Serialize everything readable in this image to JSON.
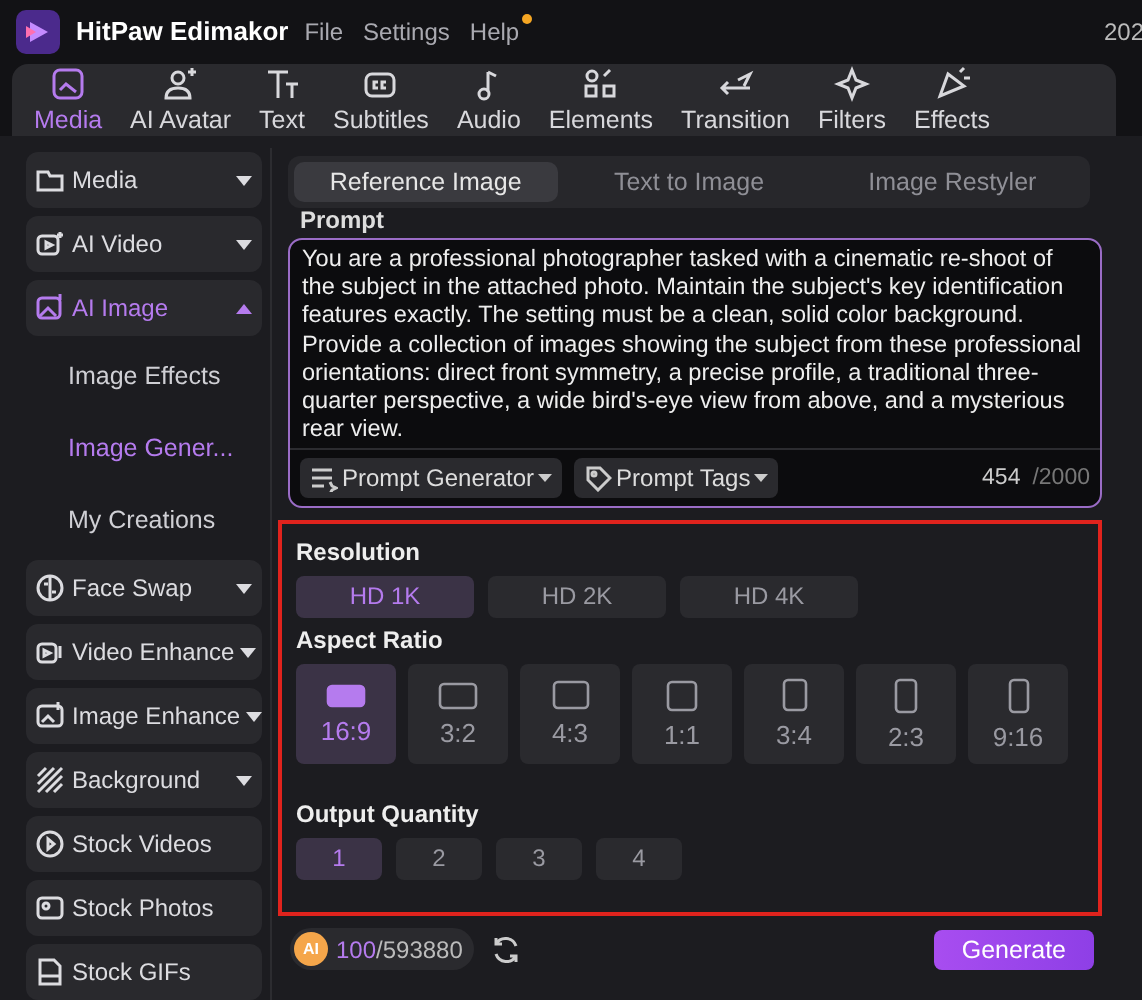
{
  "app": {
    "name": "HitPaw Edimakor",
    "menu": [
      {
        "label": "File",
        "badge": false
      },
      {
        "label": "Settings",
        "badge": false
      },
      {
        "label": "Help",
        "badge": true
      }
    ],
    "clock": "202"
  },
  "toolbar": [
    {
      "label": "Media",
      "selected": true
    },
    {
      "label": "AI Avatar",
      "selected": false
    },
    {
      "label": "Text",
      "selected": false
    },
    {
      "label": "Subtitles",
      "selected": false
    },
    {
      "label": "Audio",
      "selected": false
    },
    {
      "label": "Elements",
      "selected": false
    },
    {
      "label": "Transition",
      "selected": false
    },
    {
      "label": "Filters",
      "selected": false
    },
    {
      "label": "Effects",
      "selected": false
    }
  ],
  "sidebar": {
    "items": [
      {
        "kind": "group",
        "label": "Media",
        "expanded": false,
        "selected": false
      },
      {
        "kind": "group",
        "label": "AI Video",
        "expanded": false,
        "selected": false
      },
      {
        "kind": "group",
        "label": "AI Image",
        "expanded": true,
        "selected": true,
        "children": [
          {
            "label": "Image Effects",
            "selected": false
          },
          {
            "label": "Image Gener...",
            "selected": true
          },
          {
            "label": "My Creations",
            "selected": false
          }
        ]
      },
      {
        "kind": "group",
        "label": "Face Swap",
        "expanded": false,
        "selected": false
      },
      {
        "kind": "group",
        "label": "Video Enhance",
        "expanded": false,
        "selected": false
      },
      {
        "kind": "group",
        "label": "Image Enhance",
        "expanded": false,
        "selected": false
      },
      {
        "kind": "group",
        "label": "Background",
        "expanded": false,
        "selected": false
      },
      {
        "kind": "link",
        "label": "Stock Videos",
        "selected": false
      },
      {
        "kind": "link",
        "label": "Stock Photos",
        "selected": false
      },
      {
        "kind": "link",
        "label": "Stock GIFs",
        "selected": false
      }
    ]
  },
  "tabs": [
    {
      "label": "Reference Image",
      "selected": true
    },
    {
      "label": "Text to Image",
      "selected": false
    },
    {
      "label": "Image Restyler",
      "selected": false
    }
  ],
  "prompt": {
    "label": "Prompt",
    "value": "You are a professional photographer tasked with a cinematic re-shoot of the subject in the attached photo. Maintain the subject's key identification features exactly. The setting must be a clean, solid color background. Provide a collection of images showing the subject from these professional orientations: direct front symmetry, a precise profile, a traditional three-quarter perspective, a wide bird's-eye view from above, and a mysterious rear view.",
    "generator": "Prompt Generator",
    "tags": "Prompt Tags",
    "count": "454",
    "limit": "/2000"
  },
  "resolution": {
    "label": "Resolution",
    "options": [
      {
        "label": "HD 1K",
        "selected": true
      },
      {
        "label": "HD 2K",
        "selected": false
      },
      {
        "label": "HD 4K",
        "selected": false
      }
    ]
  },
  "aspect_ratio": {
    "label": "Aspect Ratio",
    "options": [
      {
        "label": "16:9",
        "selected": true
      },
      {
        "label": "3:2",
        "selected": false
      },
      {
        "label": "4:3",
        "selected": false
      },
      {
        "label": "1:1",
        "selected": false
      },
      {
        "label": "3:4",
        "selected": false
      },
      {
        "label": "2:3",
        "selected": false
      },
      {
        "label": "9:16",
        "selected": false
      }
    ]
  },
  "output_quantity": {
    "label": "Output Quantity",
    "options": [
      {
        "label": "1",
        "selected": true
      },
      {
        "label": "2",
        "selected": false
      },
      {
        "label": "3",
        "selected": false
      },
      {
        "label": "4",
        "selected": false
      }
    ]
  },
  "footer": {
    "coin": "AI",
    "credits": "100",
    "total": "/593880",
    "generate": "Generate"
  }
}
